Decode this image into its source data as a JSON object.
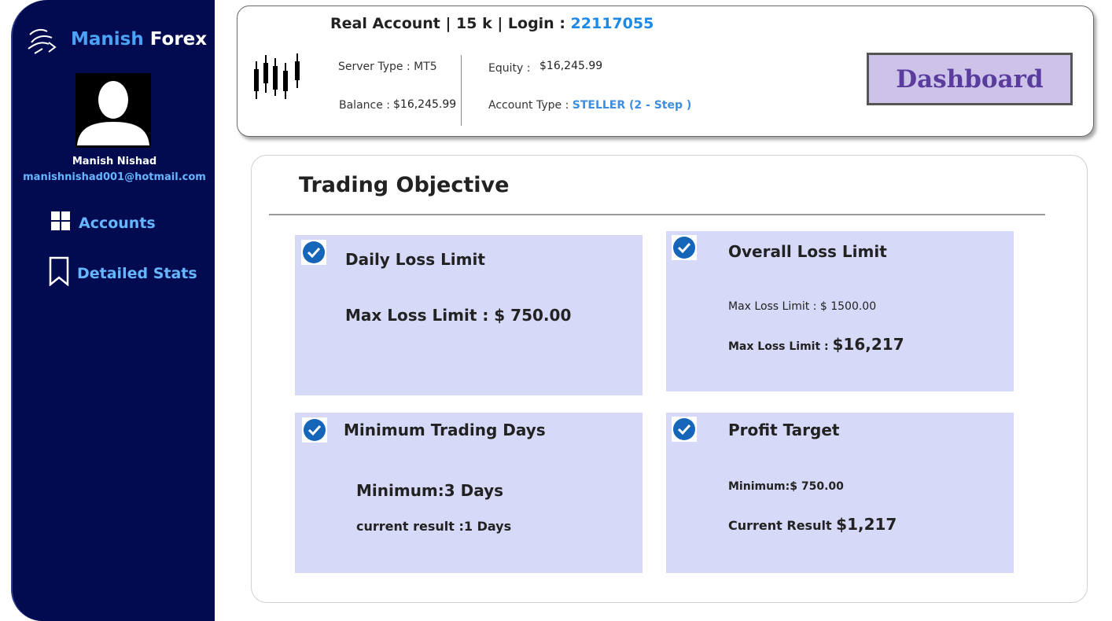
{
  "sidebar": {
    "brand_primary": "Manish",
    "brand_secondary": "Forex",
    "user_name": "Manish Nishad",
    "user_email": "manishnishad001@hotmail.com",
    "nav": [
      {
        "label": "Accounts",
        "icon": "windows-grid-icon"
      },
      {
        "label": "Detailed Stats",
        "icon": "bookmark-icon"
      }
    ]
  },
  "header": {
    "account_prefix": "Real Account |  15 k | Login : ",
    "login": "22117055",
    "server_type_label": "Server Type : ",
    "server_type_value": "MT5",
    "balance_label": "Balance : ",
    "balance_value": "$16,245.99",
    "equity_label": "Equity : ",
    "equity_value": "$16,245.99",
    "account_type_label": "Account Type : ",
    "account_type_value": "STELLER (2 - Step )",
    "dashboard_button": "Dashboard"
  },
  "objective": {
    "title": "Trading Objective",
    "tiles": [
      {
        "title": "Daily Loss Limit",
        "line1": "Max Loss Limit : $ 750.00"
      },
      {
        "title": "Overall Loss Limit",
        "line1": "Max Loss Limit : $ 1500.00",
        "line2_label": "Max Loss Limit : ",
        "line2_value": "$16,217"
      },
      {
        "title": "Minimum Trading Days",
        "line1": "Minimum:3 Days",
        "line2": "current result :1 Days"
      },
      {
        "title": "Profit Target",
        "line1": "Minimum:$ 750.00",
        "line2_label": "Current Result ",
        "line2_value": "$1,217"
      }
    ]
  },
  "colors": {
    "sidebar_bg": "#020b50",
    "accent_blue": "#4aa3f5",
    "tile_bg": "#d6d9f7",
    "check_blue": "#1565b8",
    "dashboard_bg": "#cdc3e8",
    "dashboard_text": "#5a3c9e"
  }
}
